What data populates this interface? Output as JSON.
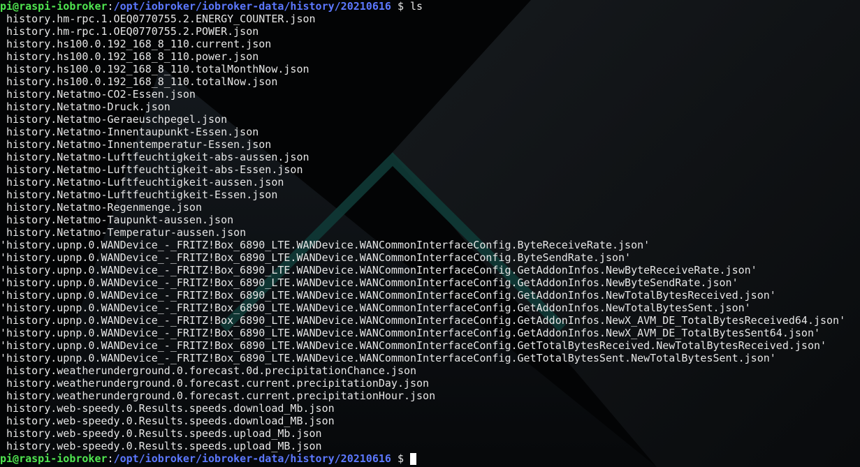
{
  "prompt": {
    "user_host": "pi@raspi-iobroker",
    "separator": ":",
    "path": "/opt/iobroker/iobroker-data/history/20210616",
    "dollar": " $ "
  },
  "command": "ls",
  "files": [
    " history.hm-rpc.1.OEQ0770755.2.ENERGY_COUNTER.json",
    " history.hm-rpc.1.OEQ0770755.2.POWER.json",
    " history.hs100.0.192_168_8_110.current.json",
    " history.hs100.0.192_168_8_110.power.json",
    " history.hs100.0.192_168_8_110.totalMonthNow.json",
    " history.hs100.0.192_168_8_110.totalNow.json",
    " history.Netatmo-CO2-Essen.json",
    " history.Netatmo-Druck.json",
    " history.Netatmo-Geraeuschpegel.json",
    " history.Netatmo-Innentaupunkt-Essen.json",
    " history.Netatmo-Innentemperatur-Essen.json",
    " history.Netatmo-Luftfeuchtigkeit-abs-aussen.json",
    " history.Netatmo-Luftfeuchtigkeit-abs-Essen.json",
    " history.Netatmo-Luftfeuchtigkeit-aussen.json",
    " history.Netatmo-Luftfeuchtigkeit-Essen.json",
    " history.Netatmo-Regenmenge.json",
    " history.Netatmo-Taupunkt-aussen.json",
    " history.Netatmo-Temperatur-aussen.json",
    "'history.upnp.0.WANDevice_-_FRITZ!Box_6890_LTE.WANDevice.WANCommonInterfaceConfig.ByteReceiveRate.json'",
    "'history.upnp.0.WANDevice_-_FRITZ!Box_6890_LTE.WANDevice.WANCommonInterfaceConfig.ByteSendRate.json'",
    "'history.upnp.0.WANDevice_-_FRITZ!Box_6890_LTE.WANDevice.WANCommonInterfaceConfig.GetAddonInfos.NewByteReceiveRate.json'",
    "'history.upnp.0.WANDevice_-_FRITZ!Box_6890_LTE.WANDevice.WANCommonInterfaceConfig.GetAddonInfos.NewByteSendRate.json'",
    "'history.upnp.0.WANDevice_-_FRITZ!Box_6890_LTE.WANDevice.WANCommonInterfaceConfig.GetAddonInfos.NewTotalBytesReceived.json'",
    "'history.upnp.0.WANDevice_-_FRITZ!Box_6890_LTE.WANDevice.WANCommonInterfaceConfig.GetAddonInfos.NewTotalBytesSent.json'",
    "'history.upnp.0.WANDevice_-_FRITZ!Box_6890_LTE.WANDevice.WANCommonInterfaceConfig.GetAddonInfos.NewX_AVM_DE_TotalBytesReceived64.json'",
    "'history.upnp.0.WANDevice_-_FRITZ!Box_6890_LTE.WANDevice.WANCommonInterfaceConfig.GetAddonInfos.NewX_AVM_DE_TotalBytesSent64.json'",
    "'history.upnp.0.WANDevice_-_FRITZ!Box_6890_LTE.WANDevice.WANCommonInterfaceConfig.GetTotalBytesReceived.NewTotalBytesReceived.json'",
    "'history.upnp.0.WANDevice_-_FRITZ!Box_6890_LTE.WANDevice.WANCommonInterfaceConfig.GetTotalBytesSent.NewTotalBytesSent.json'",
    " history.weatherunderground.0.forecast.0d.precipitationChance.json",
    " history.weatherunderground.0.forecast.current.precipitationDay.json",
    " history.weatherunderground.0.forecast.current.precipitationHour.json",
    " history.web-speedy.0.Results.speeds.download_Mb.json",
    " history.web-speedy.0.Results.speeds.download_MB.json",
    " history.web-speedy.0.Results.speeds.upload_Mb.json",
    " history.web-speedy.0.Results.speeds.upload_MB.json"
  ],
  "colors": {
    "user_host": "#50e650",
    "path": "#5c78ff",
    "text": "#e6e6e6",
    "background": "#030405"
  }
}
